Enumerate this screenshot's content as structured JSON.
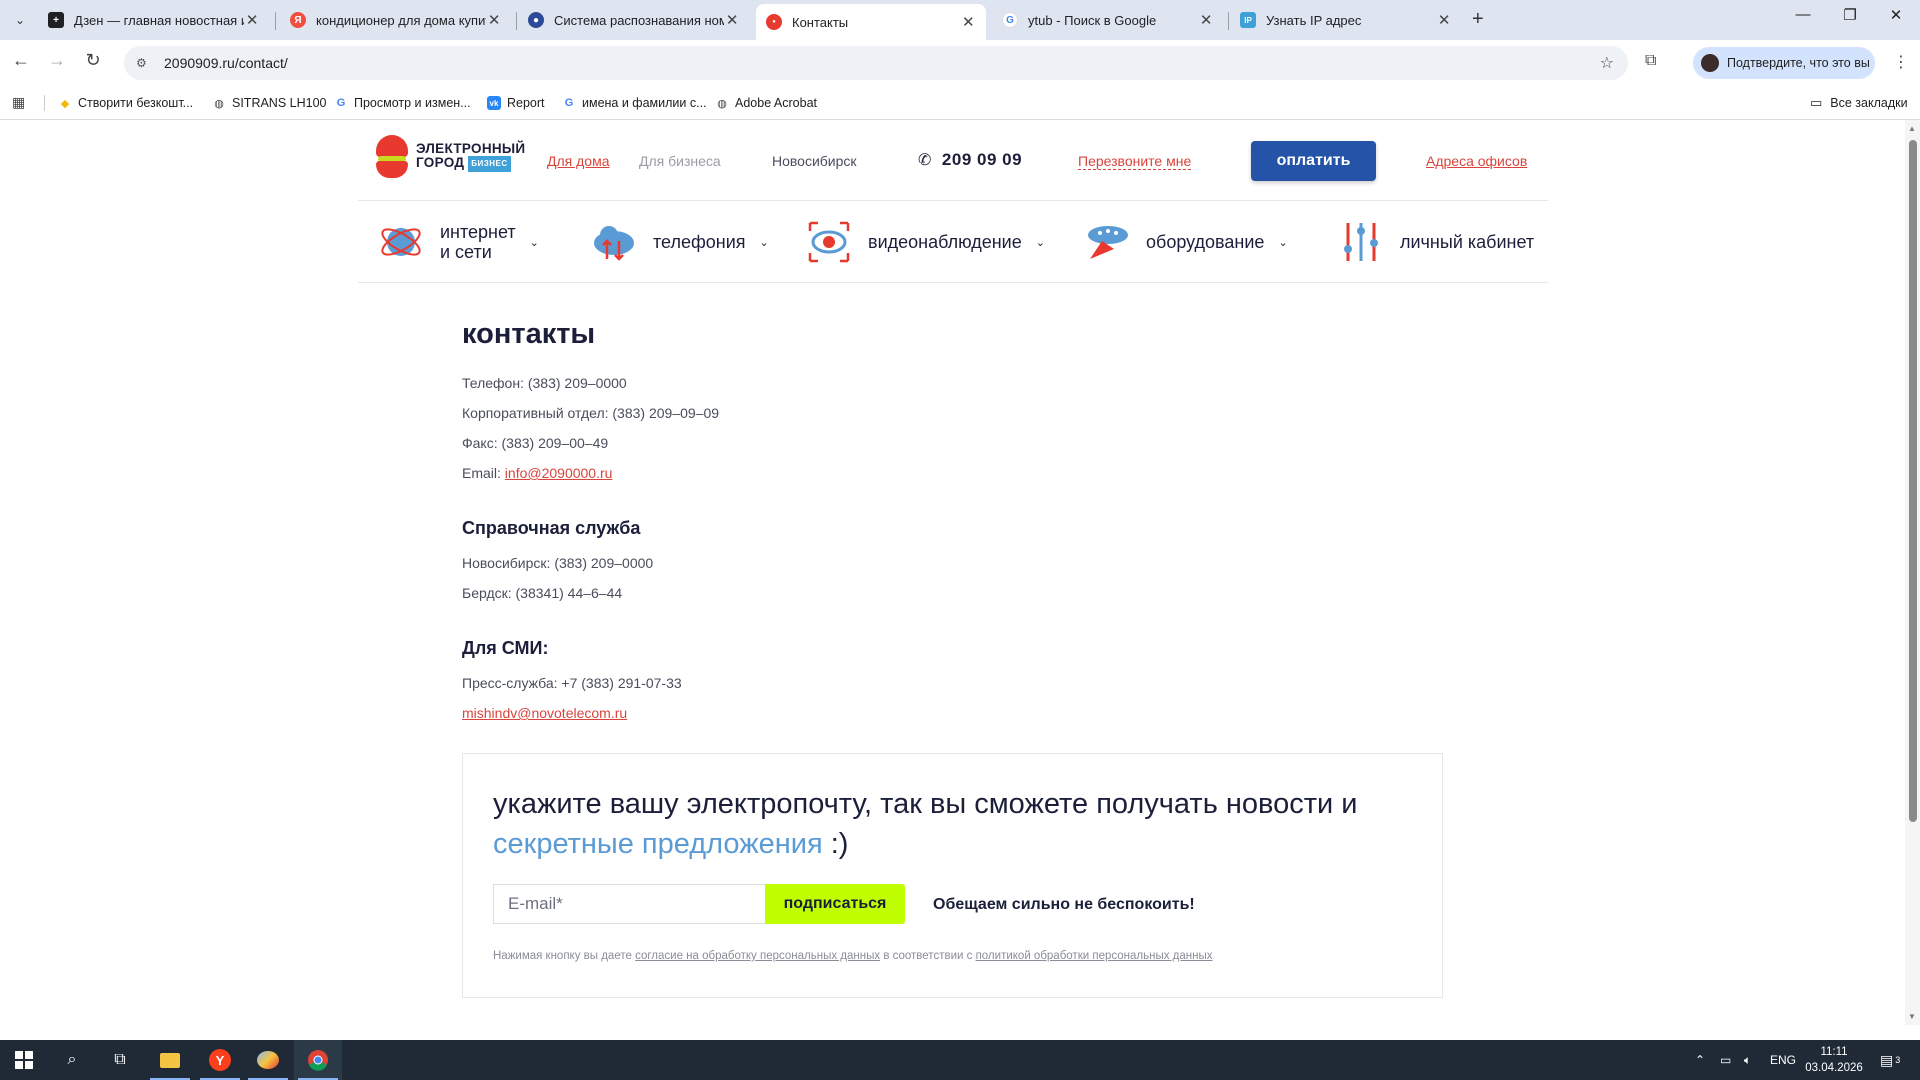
{
  "browser": {
    "tabs": [
      {
        "label": "Дзен — главная новостная ин",
        "favicon_color": "#202124",
        "favicon": "+"
      },
      {
        "label": "кондиционер для дома купить",
        "favicon_color": "#f04e3e",
        "favicon": "Я"
      },
      {
        "label": "Система распознавания номе",
        "favicon_color": "#2b4a9a",
        "favicon": "●"
      },
      {
        "label": "Контакты",
        "favicon_color": "#e8392e",
        "favicon": "●"
      },
      {
        "label": "ytub - Поиск в Google",
        "favicon_color": "#4285f4",
        "favicon": "G"
      },
      {
        "label": "Узнать IP адрес",
        "favicon_color": "#3fa1d8",
        "favicon": "IP"
      }
    ],
    "url": "2090909.ru/contact/",
    "profile_label": "Подтвердите, что это вы",
    "bookmarks": [
      {
        "label": "Створити безкошт...",
        "icon": "diamond-icon"
      },
      {
        "label": "SITRANS LH100",
        "icon": "globe-icon"
      },
      {
        "label": "Просмотр и измен...",
        "icon": "google-icon"
      },
      {
        "label": "Report",
        "icon": "vk-icon"
      },
      {
        "label": "имена и фамилии с...",
        "icon": "google-icon"
      },
      {
        "label": "Adobe Acrobat",
        "icon": "globe-icon"
      }
    ],
    "all_bookmarks": "Все закладки"
  },
  "header": {
    "logo_line1": "ЭЛЕКТРОННЫЙ",
    "logo_line2": "ГОРОД",
    "logo_badge": "БИЗНЕС",
    "link_home": "Для дома",
    "link_business": "Для бизнеса",
    "city": "Новосибирск",
    "phone": "209 09 09",
    "callback": "Перезвоните мне",
    "pay_button": "оплатить",
    "offices": "Адреса офисов"
  },
  "nav": {
    "internet_line1": "интернет",
    "internet_line2": "и сети",
    "telephony": "телефония",
    "video": "видеонаблюдение",
    "equipment": "оборудование",
    "cabinet": "личный кабинет"
  },
  "contacts": {
    "title": "контакты",
    "phone_label": "Телефон: (383) 209–0000",
    "corp_label": "Корпоративный отдел: (383) 209–09–09",
    "fax_label": "Факс: (383) 209–00–49",
    "email_prefix": "Email: ",
    "email": "info@2090000.ru",
    "help_title": "Справочная служба",
    "nsk": "Новосибирск: (383) 209–0000",
    "berdsk": "Бердск: (38341) 44–6–44",
    "media_title": "Для СМИ:",
    "press": "Пресс-служба: +7 (383) 291-07-33",
    "press_email": "mishindv@novotelecom.ru"
  },
  "subscribe": {
    "title_part1": "укажите вашу электропочту, так вы сможете получать новости и ",
    "title_highlight": "секретные предложения",
    "title_part2": " :)",
    "email_placeholder": "E-mail*",
    "button": "подписаться",
    "promise": "Обещаем сильно не беспокоить!",
    "consent_prefix": "Нажимая кнопку вы даете ",
    "consent_link1": "согласие на обработку персональных данных",
    "consent_middle": " в соответствии с ",
    "consent_link2": "политикой обработки персональных данных"
  },
  "taskbar": {
    "lang": "ENG",
    "time": "11:11",
    "date": "03.04.2026",
    "notifications": "3"
  },
  "colors": {
    "accent_red": "#d9453d",
    "brand_blue": "#2453a8",
    "lime": "#bfff00",
    "highlight_blue": "#5b9bd5"
  }
}
